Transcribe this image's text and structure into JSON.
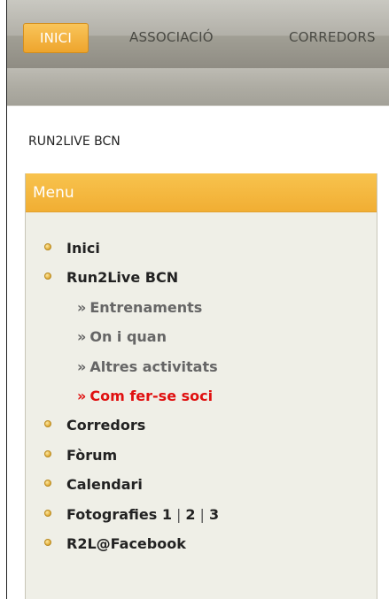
{
  "nav": {
    "tabs": [
      {
        "label": "INICI",
        "active": true
      },
      {
        "label": "ASSOCIACIÓ",
        "active": false
      },
      {
        "label": "CORREDORS",
        "active": false
      }
    ]
  },
  "site": {
    "title": "RUN2LIVE BCN"
  },
  "menu": {
    "header": "Menu",
    "items": [
      {
        "label": "Inici",
        "level": 1
      },
      {
        "label": "Run2Live BCN",
        "level": 1
      },
      {
        "label": "Entrenaments",
        "level": 2,
        "prefix": "»"
      },
      {
        "label": "On i quan",
        "level": 2,
        "prefix": "»"
      },
      {
        "label": "Altres activitats",
        "level": 2,
        "prefix": "»"
      },
      {
        "label": "Com fer-se soci",
        "level": 2,
        "prefix": "»"
      },
      {
        "label": "Corredors",
        "level": 1
      },
      {
        "label": "Fòrum",
        "level": 1
      },
      {
        "label": "Calendari",
        "level": 1
      },
      {
        "label": "Fotografies",
        "level": 1,
        "links": [
          "1",
          "2",
          "3"
        ],
        "separator": "|"
      },
      {
        "label": "R2L@Facebook",
        "level": 1
      }
    ]
  },
  "colors": {
    "accent": "#f1ae33",
    "highlight_link": "#e01010",
    "menu_bg": "#efefe7",
    "nav_bg": "#a3a198"
  },
  "icons": {
    "bullet": "yellow-dot-icon"
  }
}
